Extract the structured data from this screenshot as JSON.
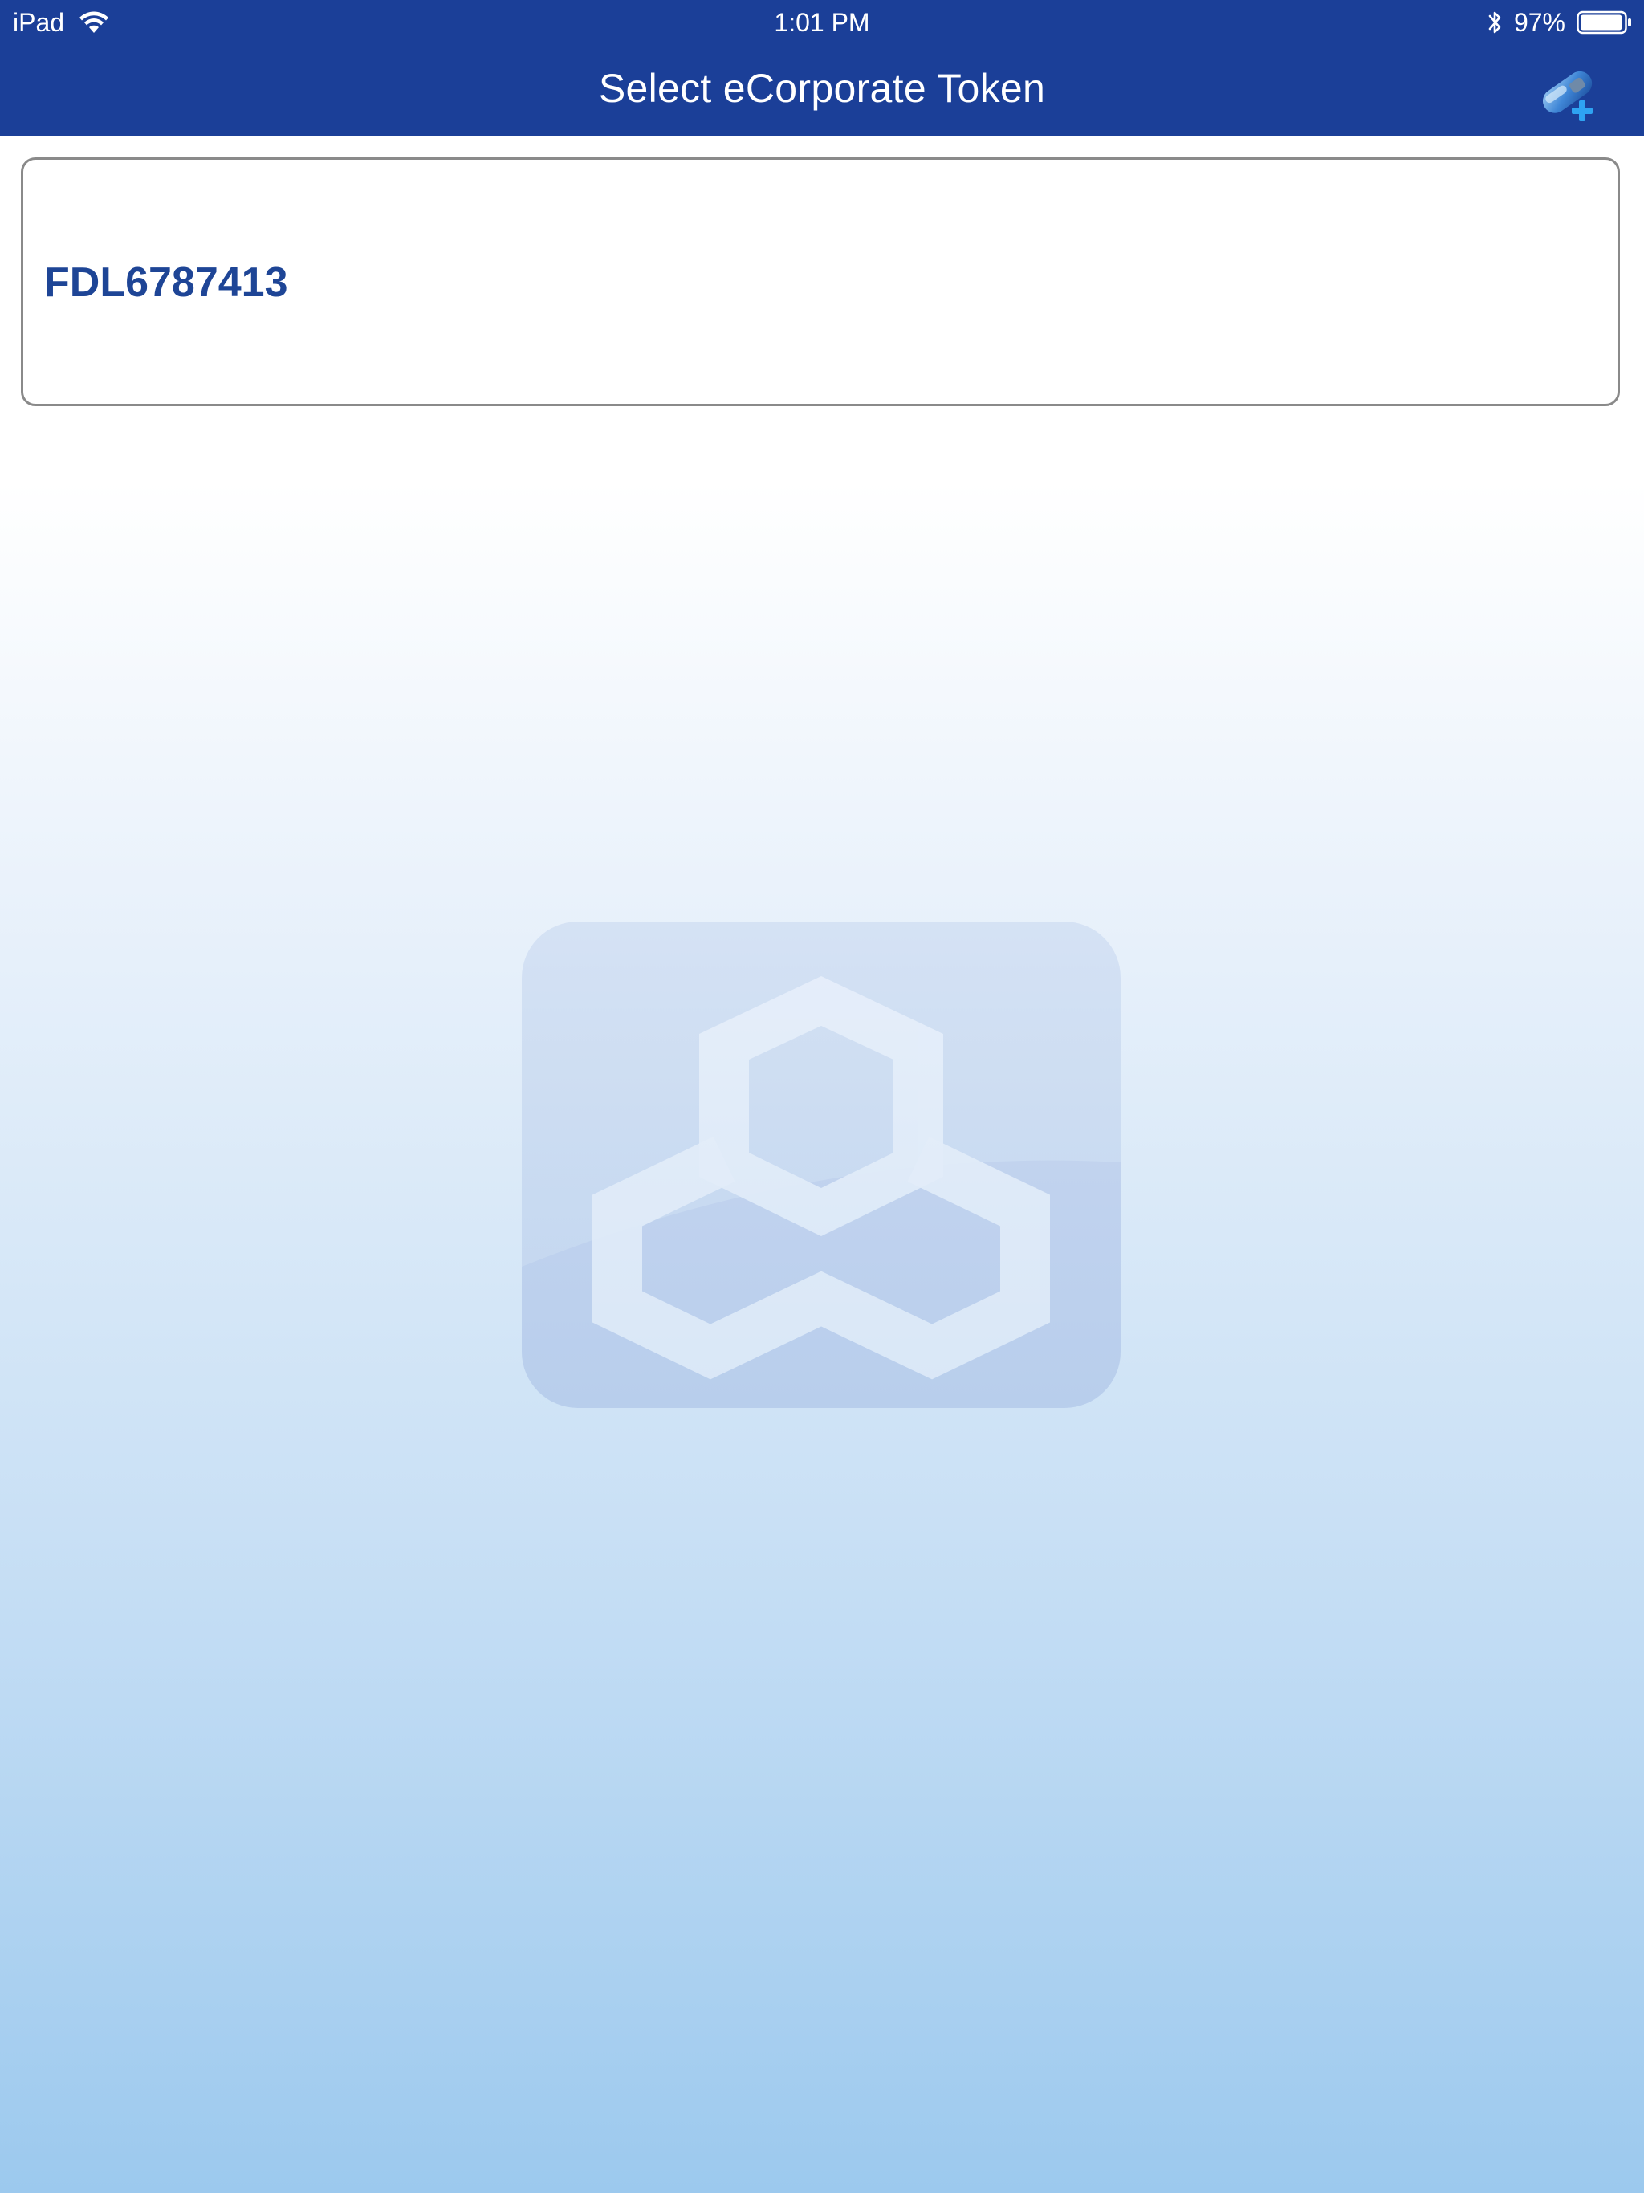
{
  "status_bar": {
    "device": "iPad",
    "time": "1:01 PM",
    "battery_percent": "97%",
    "battery_level": 0.97,
    "icons": [
      "wifi-icon",
      "bluetooth-icon",
      "battery-icon"
    ]
  },
  "nav_bar": {
    "title": "Select eCorporate Token",
    "action_icon": "add-token-icon"
  },
  "tokens": [
    {
      "id": "FDL6787413"
    }
  ],
  "background": {
    "watermark_icon": "bank-logo-icon"
  },
  "colors": {
    "nav_background": "#1b3f98",
    "token_text": "#1e4596",
    "card_border": "#8a8a8a",
    "accent": "#2ea3f2"
  }
}
